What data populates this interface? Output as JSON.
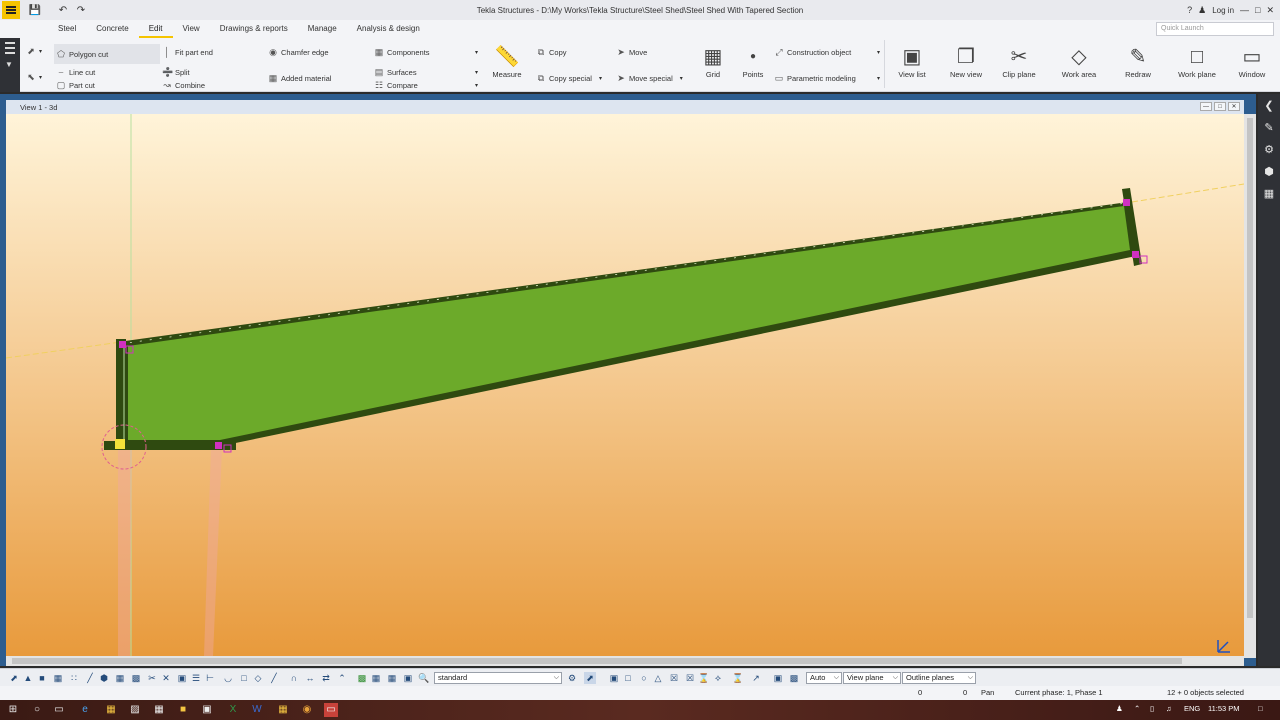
{
  "app": {
    "title": "Tekla Structures - D:\\My Works\\Tekla Structure\\Steel Shed\\Steel Shed With Tapered Section",
    "login_label": "Log in",
    "quick_launch_placeholder": "Quick Launch"
  },
  "menu": {
    "tabs": [
      "Steel",
      "Concrete",
      "Edit",
      "View",
      "Drawings & reports",
      "Manage",
      "Analysis & design"
    ],
    "active": "Edit"
  },
  "ribbon": {
    "polygon_cut": "Polygon cut",
    "line_cut": "Line cut",
    "part_cut": "Part cut",
    "fit_part_end": "Fit part end",
    "split": "Split",
    "combine": "Combine",
    "chamfer_edge": "Chamfer edge",
    "added_material": "Added material",
    "components": "Components",
    "surfaces": "Surfaces",
    "compare": "Compare",
    "measure": "Measure",
    "copy": "Copy",
    "copy_special": "Copy special",
    "move": "Move",
    "move_special": "Move special",
    "grid": "Grid",
    "points": "Points",
    "construction_object": "Construction object",
    "parametric_modeling": "Parametric modeling",
    "view_list": "View list",
    "new_view": "New view",
    "clip_plane": "Clip plane",
    "work_area": "Work area",
    "redraw": "Redraw",
    "work_plane": "Work plane",
    "window": "Window"
  },
  "view": {
    "title": "View 1 - 3d"
  },
  "bottom_toolbar": {
    "filter": "standard",
    "snap_depth": "Auto",
    "plane": "View plane",
    "outline": "Outline planes"
  },
  "status": {
    "x": "0",
    "y": "0",
    "mode": "Pan",
    "phase": "Current phase: 1, Phase 1",
    "selection": "12 + 0 objects selected"
  },
  "taskbar": {
    "language": "ENG",
    "time": "11:53 PM"
  },
  "colors": {
    "beam_fill": "#6caa2a",
    "beam_edge": "#2f4a10",
    "handle": "#d030c0",
    "accent": "#f5c400"
  }
}
